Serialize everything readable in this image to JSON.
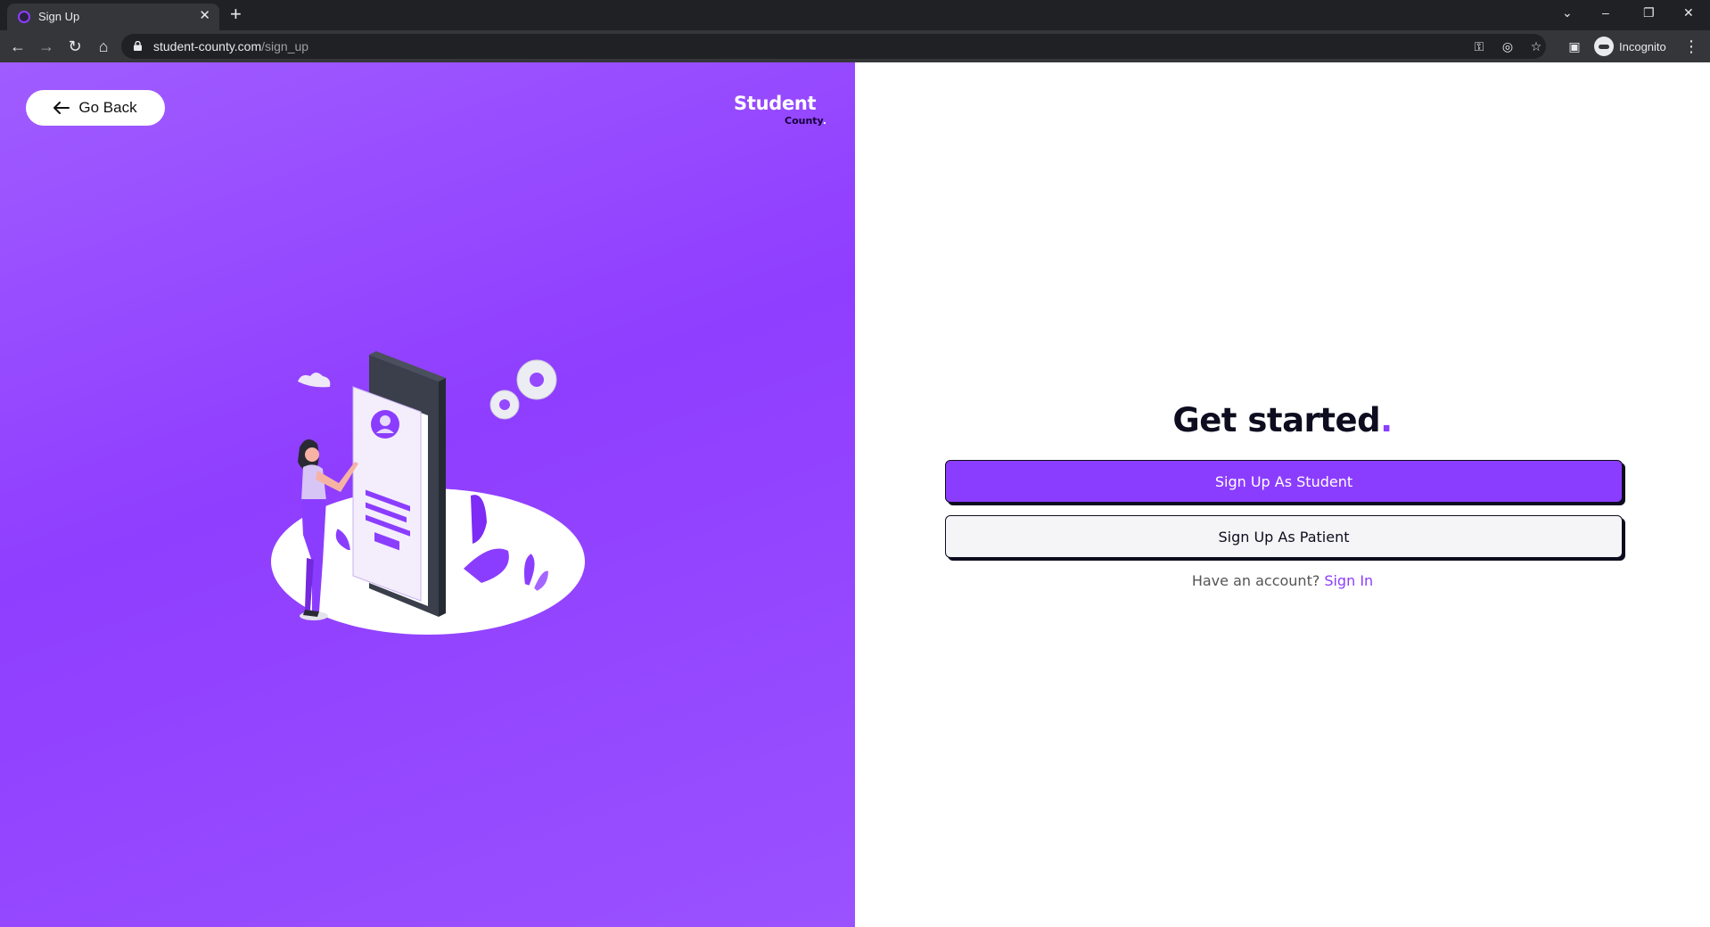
{
  "browser": {
    "tab_title": "Sign Up",
    "url_host": "student-county.com",
    "url_path": "/sign_up",
    "profile_label": "Incognito"
  },
  "page": {
    "go_back_label": "Go Back",
    "brand": {
      "main": "Student",
      "sub": "County",
      "dot": "."
    },
    "heading": "Get started",
    "heading_dot": ".",
    "student_button": "Sign Up As Student",
    "patient_button": "Sign Up As Patient",
    "have_account": "Have an account?",
    "signin_link": "Sign In"
  },
  "colors": {
    "accent": "#8b3dff",
    "panel_purple": "#9448ff",
    "dark_text": "#0d0d1f"
  }
}
